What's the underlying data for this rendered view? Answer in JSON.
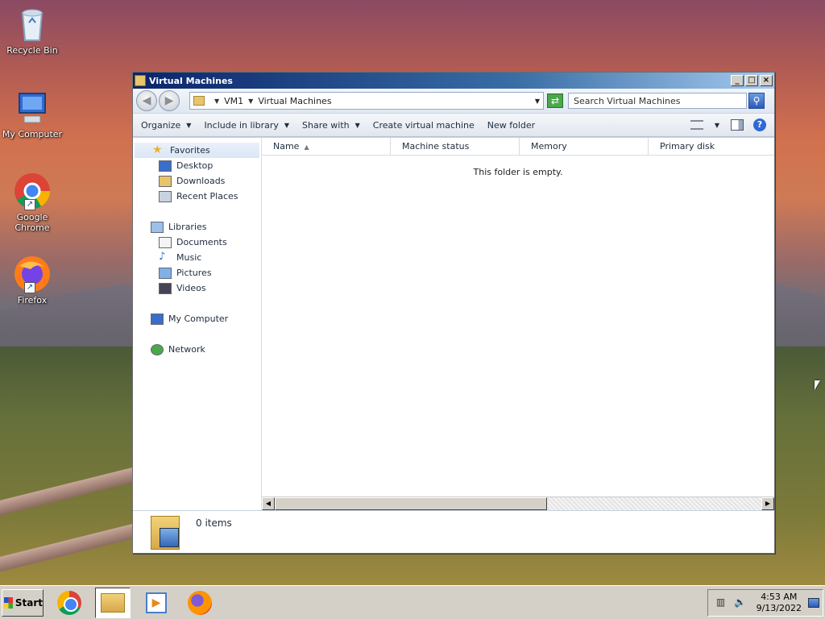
{
  "desktop": {
    "icons": [
      {
        "label": "Recycle Bin",
        "icon": "recycle-bin-icon"
      },
      {
        "label": "My Computer",
        "icon": "computer-icon"
      },
      {
        "label": "Google Chrome",
        "icon": "chrome-icon"
      },
      {
        "label": "Firefox",
        "icon": "firefox-icon"
      }
    ]
  },
  "window": {
    "title": "Virtual Machines",
    "address": {
      "crumbs": [
        "VM1",
        "Virtual Machines"
      ]
    },
    "search": {
      "placeholder": "Search Virtual Machines"
    },
    "commands": [
      {
        "label": "Organize",
        "dropdown": true
      },
      {
        "label": "Include in library",
        "dropdown": true
      },
      {
        "label": "Share with",
        "dropdown": true
      },
      {
        "label": "Create virtual machine",
        "dropdown": false
      },
      {
        "label": "New folder",
        "dropdown": false
      }
    ],
    "nav": {
      "favorites": {
        "label": "Favorites",
        "items": [
          "Desktop",
          "Downloads",
          "Recent Places"
        ]
      },
      "libraries": {
        "label": "Libraries",
        "items": [
          "Documents",
          "Music",
          "Pictures",
          "Videos"
        ]
      },
      "computer": "My Computer",
      "network": "Network"
    },
    "columns": [
      "Name",
      "Machine status",
      "Memory",
      "Primary disk"
    ],
    "empty_message": "This folder is empty.",
    "status": {
      "items_count": "0 items"
    }
  },
  "taskbar": {
    "start_label": "Start",
    "apps": [
      "chrome-icon",
      "explorer-icon",
      "media-player-icon",
      "firefox-icon"
    ],
    "clock": {
      "time": "4:53 AM",
      "date": "9/13/2022"
    }
  },
  "colors": {
    "titlebar_start": "#0a246a",
    "titlebar_end": "#a6caf0",
    "chrome_face": "#d4d0c8"
  }
}
